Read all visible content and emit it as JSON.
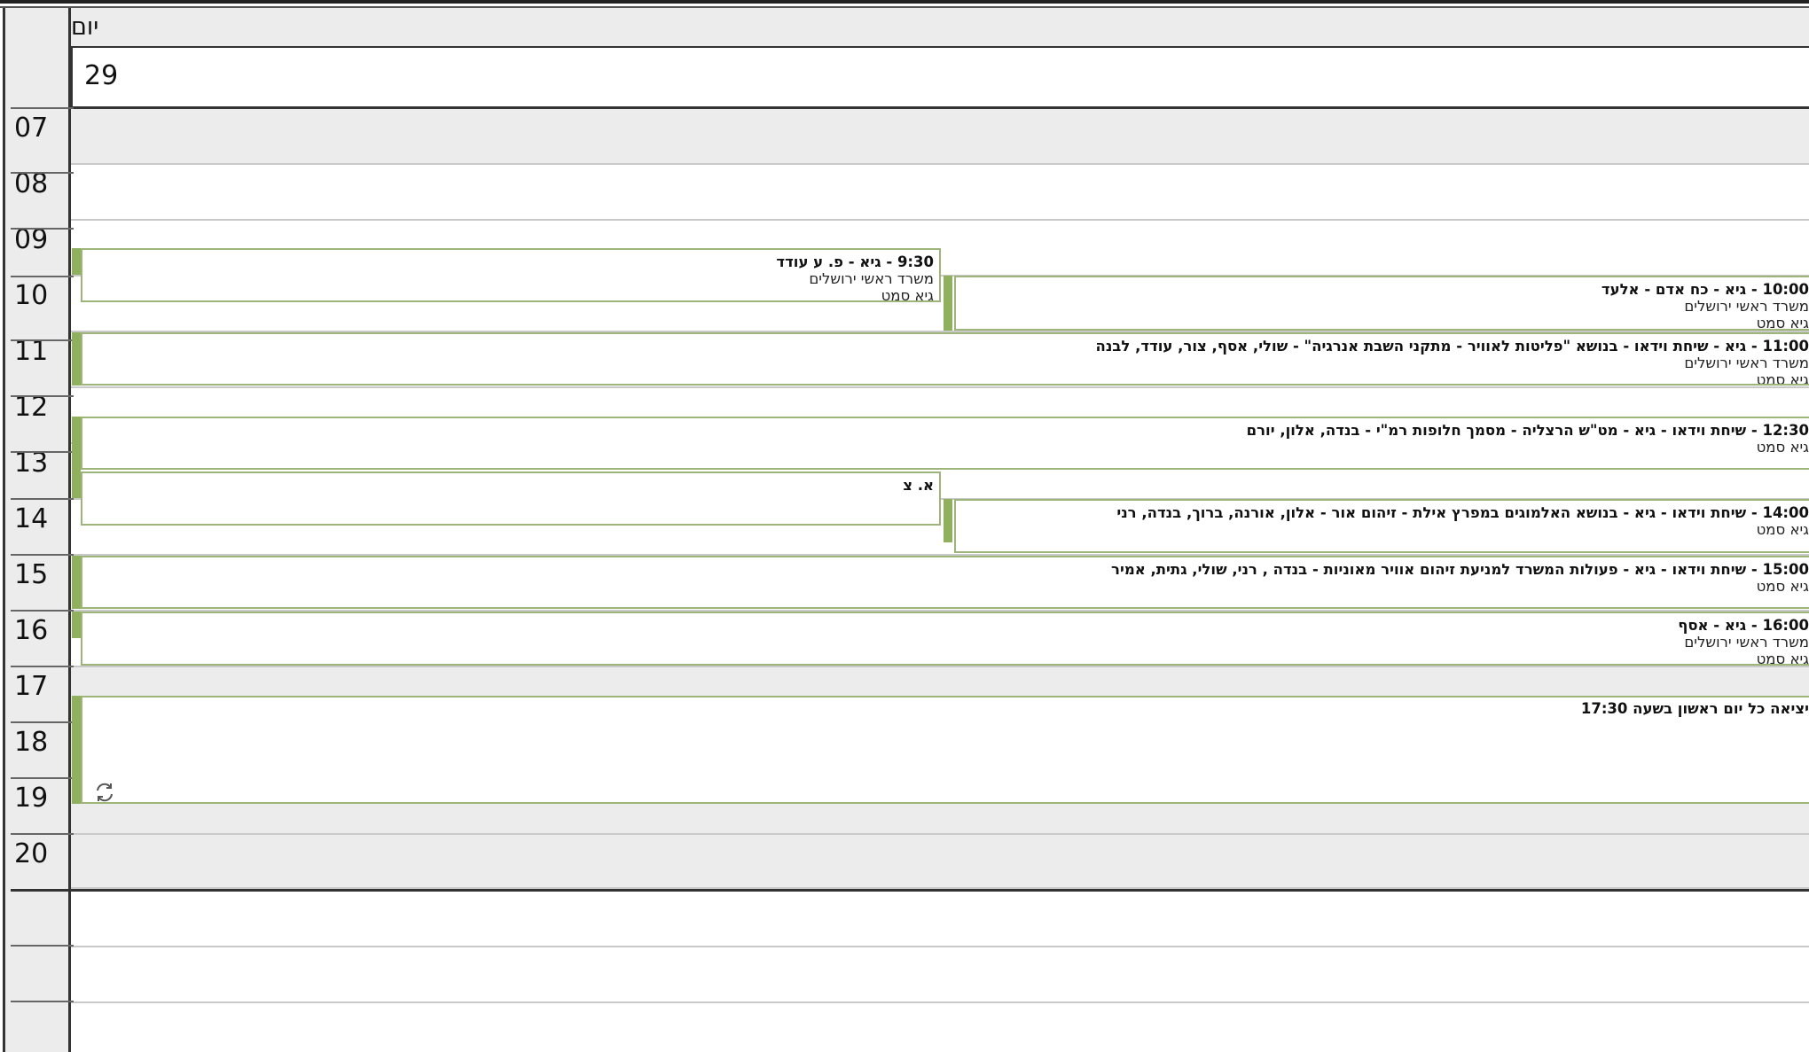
{
  "day": {
    "name": "יום ראשון",
    "date": "29"
  },
  "hours": [
    "07",
    "08",
    "09",
    "10",
    "11",
    "12",
    "13",
    "14",
    "15",
    "16",
    "17",
    "18",
    "19",
    "20"
  ],
  "events": [
    {
      "id": "e1",
      "title": "9:30 - גיא - פ. ע עודד",
      "lines": [
        "משרד ראשי ירושלים",
        "גיא סמט"
      ]
    },
    {
      "id": "e2",
      "title": "10:00 - גיא -  כח אדם - אלעד",
      "lines": [
        "משרד ראשי ירושלים",
        "גיא סמט"
      ]
    },
    {
      "id": "e3",
      "title": "11:00 - גיא - שיחת וידאו - בנושא \"פליטות לאוויר - מתקני השבת אנרגיה\" - שולי, אסף, צור, עודד, לבנה",
      "lines": [
        "משרד ראשי ירושלים",
        "גיא סמט"
      ]
    },
    {
      "id": "e4",
      "title": "12:30 - שיחת וידאו - גיא - מט\"ש הרצליה - מסמך חלופות רמ\"י - בנדה, אלון, יורם",
      "lines": [
        "גיא סמט"
      ]
    },
    {
      "id": "e5",
      "title": "א. צ",
      "lines": []
    },
    {
      "id": "e6",
      "title": "14:00 - שיחת וידאו - גיא - בנושא האלמוגים במפרץ אילת - זיהום אור - אלון, אורנה, ברוך, בנדה, רני",
      "lines": [
        "גיא סמט"
      ]
    },
    {
      "id": "e7",
      "title": "15:00 - שיחת וידאו - גיא - פעולות המשרד למניעת זיהום אוויר מאוניות - בנדה , רני, שולי, גתית, אמיר",
      "lines": [
        "גיא סמט"
      ]
    },
    {
      "id": "e8",
      "title": "16:00 - גיא - אסף",
      "lines": [
        "משרד ראשי ירושלים",
        "גיא סמט"
      ]
    },
    {
      "id": "e9",
      "title": "יציאה כל יום ראשון בשעה 17:30",
      "lines": [],
      "recurring_icon": "recurrence-icon"
    }
  ],
  "colors": {
    "event_border": "#9db47a",
    "event_bar": "#8fb05c",
    "work_bg": "#ececec"
  }
}
